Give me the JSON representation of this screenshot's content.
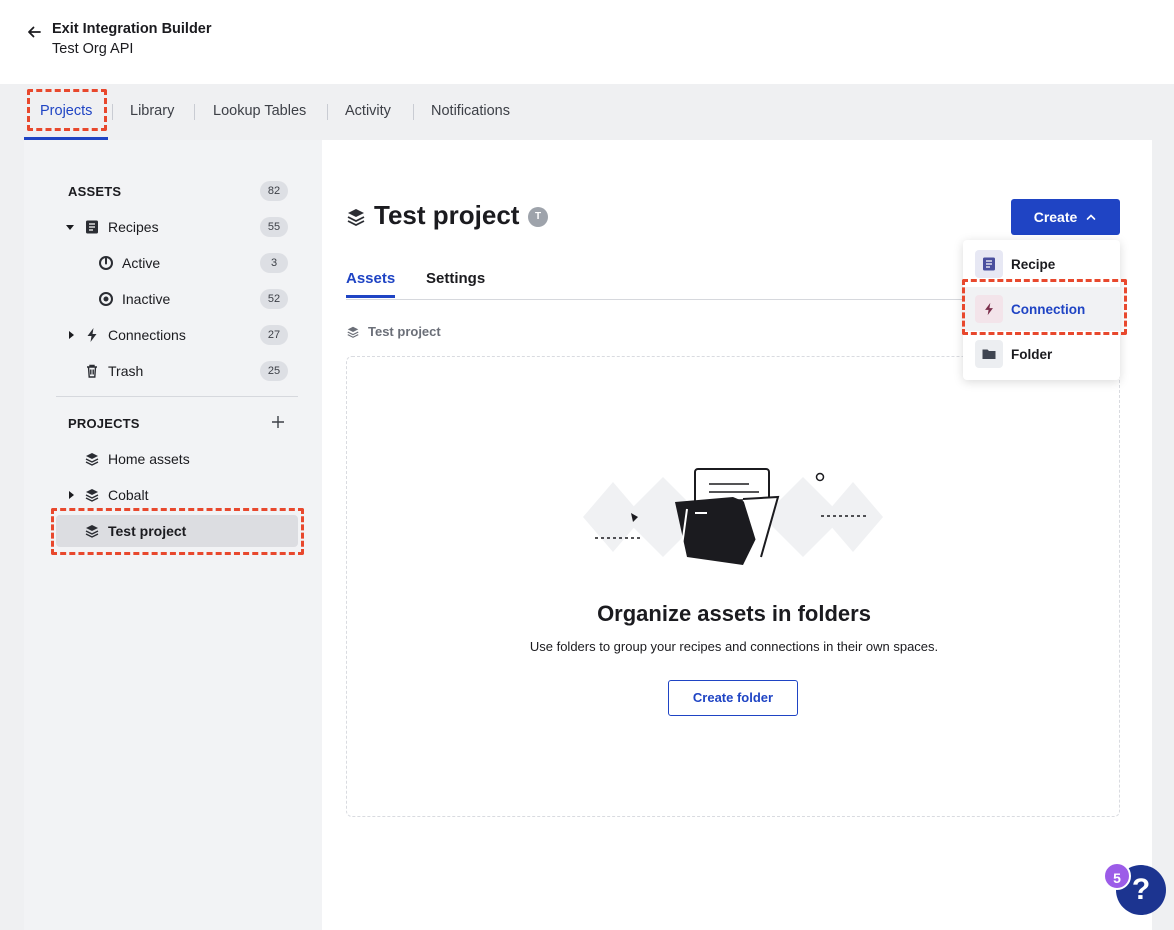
{
  "header": {
    "exit_label": "Exit Integration Builder",
    "org_name": "Test Org API"
  },
  "tabs": [
    {
      "label": "Projects",
      "active": true
    },
    {
      "label": "Library"
    },
    {
      "label": "Lookup Tables"
    },
    {
      "label": "Activity"
    },
    {
      "label": "Notifications"
    }
  ],
  "sidebar": {
    "assets_title": "ASSETS",
    "assets_count": "82",
    "recipes": {
      "label": "Recipes",
      "count": "55"
    },
    "active": {
      "label": "Active",
      "count": "3"
    },
    "inactive": {
      "label": "Inactive",
      "count": "52"
    },
    "connections": {
      "label": "Connections",
      "count": "27"
    },
    "trash": {
      "label": "Trash",
      "count": "25"
    },
    "projects_title": "PROJECTS",
    "projects": [
      {
        "label": "Home assets"
      },
      {
        "label": "Cobalt"
      },
      {
        "label": "Test project",
        "selected": true
      }
    ]
  },
  "content": {
    "project_title": "Test project",
    "owner_initial": "T",
    "create_label": "Create",
    "tabs": [
      {
        "label": "Assets",
        "active": true
      },
      {
        "label": "Settings"
      }
    ],
    "breadcrumb": "Test project",
    "empty_title": "Organize assets in folders",
    "empty_subtitle": "Use folders to group your recipes and connections in their own spaces.",
    "create_folder_label": "Create folder"
  },
  "dropdown": {
    "items": [
      {
        "label": "Recipe",
        "icon": "recipe-icon"
      },
      {
        "label": "Connection",
        "icon": "lightning-icon",
        "hovered": true
      },
      {
        "label": "Folder",
        "icon": "folder-icon"
      }
    ]
  },
  "help": {
    "badge_count": "5",
    "symbol": "?"
  },
  "colors": {
    "brand_blue": "#1f44c4",
    "highlight_red": "#e8482d",
    "badge_purple": "#9c5ce8"
  }
}
